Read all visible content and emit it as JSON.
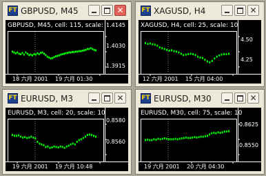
{
  "app_icon_text": "FT",
  "colors": {
    "chart_bg": "#000000",
    "frame": "#ffffff",
    "series": "#00ff00",
    "dotted": "#808080"
  },
  "windows": [
    {
      "title": "GBPUSD, M45",
      "header": "GBPUSD, M45, cell: 115, scale:",
      "price_labels": [
        "1.4145",
        "1.4030",
        "1.3915"
      ],
      "time_labels": [
        "18 六月 2001",
        "19 六月 01:30"
      ],
      "close_active": true,
      "series": [
        0.52,
        0.5,
        0.48,
        0.5,
        0.47,
        0.46,
        0.49,
        0.45,
        0.5,
        0.47,
        0.44,
        0.45,
        0.43,
        0.46,
        0.45,
        0.48,
        0.46,
        0.49,
        0.5,
        0.47,
        0.44,
        0.4,
        0.38,
        0.36,
        0.37,
        0.39,
        0.41,
        0.42,
        0.43,
        0.45,
        0.46,
        0.47,
        0.48,
        0.49,
        0.5,
        0.5,
        0.51,
        0.51,
        0.52,
        0.52,
        0.53,
        0.53,
        0.54,
        0.55,
        0.56,
        0.58,
        0.58,
        0.6,
        0.58,
        0.56,
        0.55
      ]
    },
    {
      "title": "XAGUSD, H4",
      "header": "XAGUSD, H4, cell: 25, scale: 10",
      "price_labels": [
        "4.50",
        "4.25"
      ],
      "time_labels": [
        "12 六月 2001",
        "15 六月 04:00"
      ],
      "close_active": false,
      "series": [
        0.72,
        0.7,
        0.71,
        0.69,
        0.68,
        0.66,
        0.62,
        0.6,
        0.58,
        0.56,
        0.54,
        0.55,
        0.53,
        0.52,
        0.5,
        0.47,
        0.44,
        0.45,
        0.46,
        0.47,
        0.46,
        0.44,
        0.4,
        0.38,
        0.37,
        0.33,
        0.29,
        0.27,
        0.3,
        0.36,
        0.4,
        0.43,
        0.45,
        0.46,
        0.46,
        0.47
      ]
    },
    {
      "title": "EURUSD, M3",
      "header": "EURUSD, M3, cell: 20, scale: 10",
      "price_labels": [
        "0.8580",
        "0.8560"
      ],
      "time_labels": [
        "19 六月 2001",
        "19 六月 10:48"
      ],
      "close_active": false,
      "series": [
        0.62,
        0.6,
        0.6,
        0.61,
        0.58,
        0.56,
        0.57,
        0.55,
        0.56,
        0.58,
        0.56,
        0.54,
        0.46,
        0.42,
        0.4,
        0.38,
        0.34,
        0.35,
        0.32,
        0.33,
        0.35,
        0.34,
        0.33,
        0.35,
        0.34,
        0.32,
        0.35,
        0.37,
        0.4,
        0.42,
        0.4,
        0.46,
        0.5,
        0.52,
        0.55,
        0.58,
        0.62,
        0.63,
        0.62,
        0.6,
        0.58
      ]
    },
    {
      "title": "EURUSD, M30",
      "header": "EURUSD, M30, cell: 75, scale: 10",
      "price_labels": [
        "0.8625",
        "0.8550"
      ],
      "time_labels": [
        "19 六月 2001",
        "20 六月 04:30"
      ],
      "close_active": false,
      "series": [
        0.5,
        0.51,
        0.5,
        0.5,
        0.52,
        0.51,
        0.53,
        0.52,
        0.53,
        0.54,
        0.53,
        0.52,
        0.52,
        0.52,
        0.53,
        0.52,
        0.53,
        0.54,
        0.55,
        0.56,
        0.55,
        0.55,
        0.56,
        0.57,
        0.56,
        0.57,
        0.58,
        0.58,
        0.59,
        0.6,
        0.63,
        0.66,
        0.67,
        0.66,
        0.68,
        0.67,
        0.68,
        0.7,
        0.7,
        0.71
      ]
    }
  ]
}
